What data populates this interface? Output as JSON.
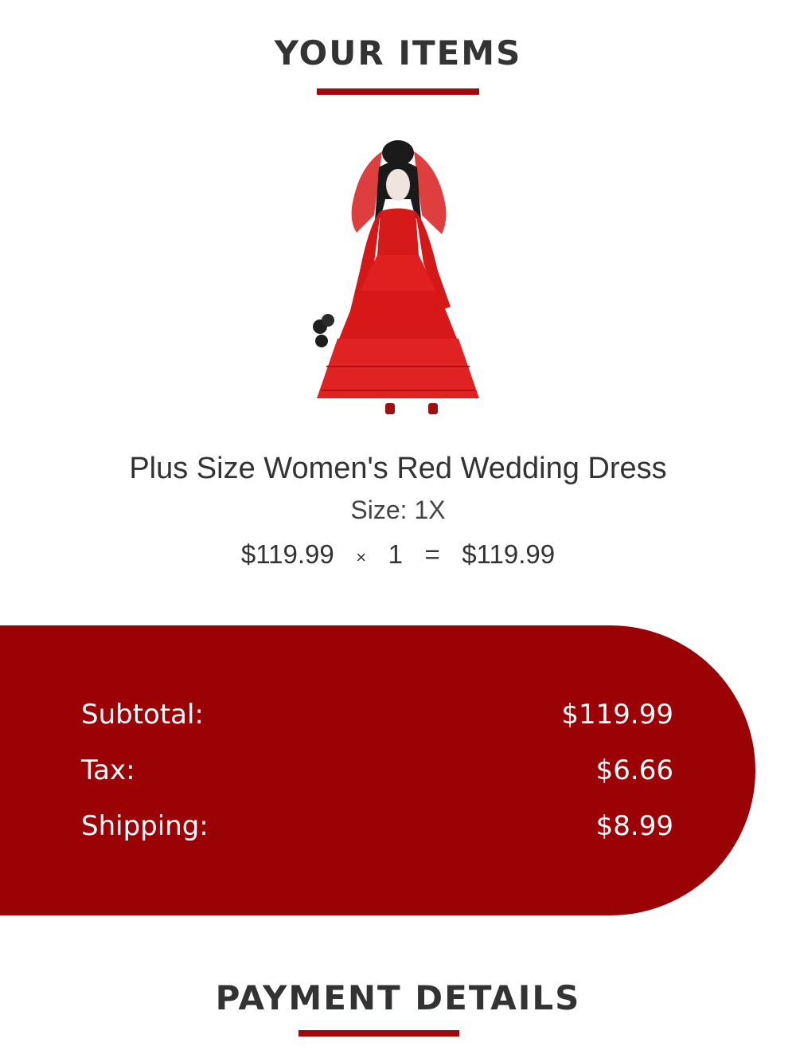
{
  "your_items": {
    "title": "YOUR ITEMS"
  },
  "product": {
    "name": "Plus Size Women's Red Wedding Dress",
    "size": "Size: 1X",
    "unit_price": "$119.99",
    "times": "×",
    "quantity": "1",
    "equals": "=",
    "line_total": "$119.99",
    "image_icon": "red-wedding-dress-costume-photo"
  },
  "totals": {
    "subtotal_label": "Subtotal:",
    "subtotal_value": "$119.99",
    "tax_label": "Tax:",
    "tax_value": "$6.66",
    "shipping_label": "Shipping:",
    "shipping_value": "$8.99"
  },
  "payment": {
    "title": "PAYMENT DETAILS"
  },
  "colors": {
    "accent": "#9b0206",
    "text": "#333333",
    "background": "#ffffff"
  }
}
